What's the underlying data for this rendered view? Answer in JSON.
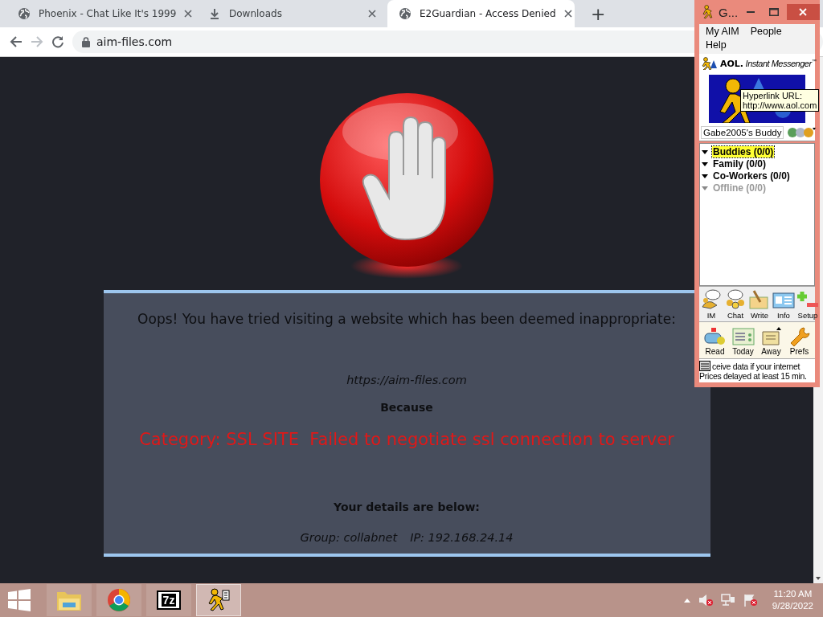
{
  "browser": {
    "tabs": [
      {
        "title": "Phoenix - Chat Like It's 1999",
        "kind": "page",
        "selected": false
      },
      {
        "title": "Downloads",
        "kind": "downloads",
        "selected": false
      },
      {
        "title": "E2Guardian - Access Denied",
        "kind": "page",
        "selected": true
      }
    ],
    "new_tab": "+",
    "address": "aim-files.com"
  },
  "page": {
    "heading": "Oops! You have tried visiting a website which has been deemed inappropriate:",
    "url": "https://aim-files.com",
    "because": "Because",
    "reason": "Category: SSL SITE  Failed to negotiate ssl connection to server",
    "details_heading": "Your details are below:",
    "group": "Group: collabnet",
    "ip": "IP: 192.168.24.14"
  },
  "aim": {
    "title": "G...",
    "menu": [
      [
        "My AIM",
        "People"
      ],
      [
        "Help"
      ]
    ],
    "logo_brand": "AOL.",
    "logo_product": "Instant Messenger",
    "logo_mark": "™",
    "tooltip": {
      "title": "Hyperlink URL:",
      "url": "http://www.aol.com"
    },
    "buddy_list_name": "Gabe2005's Buddy",
    "groups": [
      {
        "label": "Buddies (0/0)",
        "selected": true,
        "offline": false
      },
      {
        "label": "Family (0/0)",
        "selected": false,
        "offline": false
      },
      {
        "label": "Co-Workers (0/0)",
        "selected": false,
        "offline": false
      },
      {
        "label": "Offline (0/0)",
        "selected": false,
        "offline": true
      }
    ],
    "actions": [
      {
        "label": "IM",
        "kind": "im"
      },
      {
        "label": "Chat",
        "kind": "chat"
      },
      {
        "label": "Write",
        "kind": "write"
      },
      {
        "label": "Info",
        "kind": "info"
      },
      {
        "label": "Setup",
        "kind": "setup"
      }
    ],
    "actions_2": [
      {
        "label": "Read",
        "kind": "read"
      },
      {
        "label": "Today",
        "kind": "today"
      },
      {
        "label": "Away",
        "kind": "away"
      },
      {
        "label": "Prefs",
        "kind": "prefs"
      }
    ],
    "ticker": "ceive data if your internet",
    "ticker_note": "Prices delayed at least 15 min."
  },
  "taskbar": {
    "apps": [
      {
        "kind": "explorer",
        "selected": false
      },
      {
        "kind": "chrome",
        "selected": false
      },
      {
        "kind": "archiver",
        "label": "7z",
        "selected": false
      },
      {
        "kind": "aim",
        "selected": true
      }
    ],
    "time": "11:20 AM",
    "date": "9/28/2022"
  }
}
